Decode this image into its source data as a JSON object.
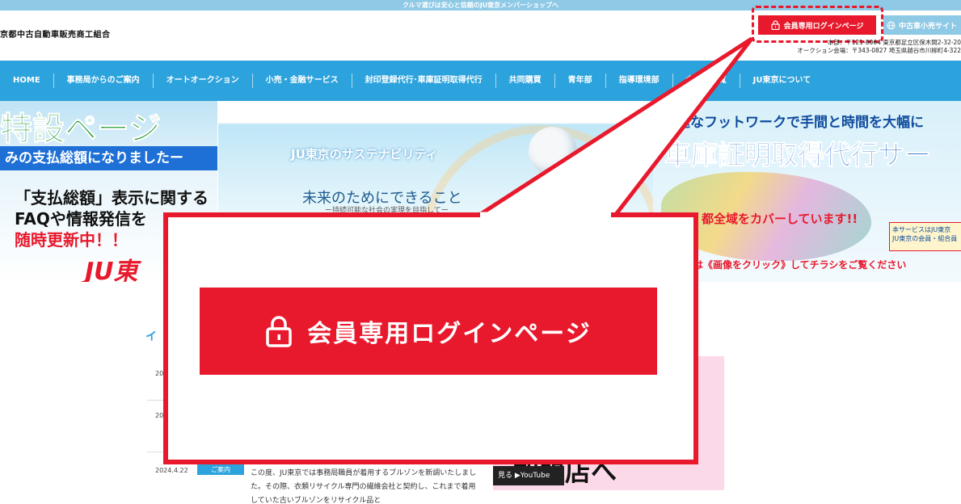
{
  "topbar": {
    "text": "クルマ選びは安心と信頼のJU東京メンバーショップへ"
  },
  "header": {
    "org_name": "京都中古自動車販売商工組合",
    "login_button": "会員専用ログインページ",
    "used_car_button": "中古車小売サイト",
    "address_line1": "本部：〒121-0064 東京都足立区保木間2-32-20",
    "address_line2": "オークション会場：〒343-0827 埼玉県越谷市川柳町4-322"
  },
  "nav": {
    "items": [
      {
        "label": "HOME"
      },
      {
        "label": "事務局からのご案内"
      },
      {
        "label": "オートオークション"
      },
      {
        "label": "小売・金融サービス"
      },
      {
        "label": "封印登録代行･車庫証明取得代行"
      },
      {
        "label": "共同購買"
      },
      {
        "label": "青年部"
      },
      {
        "label": "指導環境部"
      },
      {
        "label": "会員店一覧"
      },
      {
        "label": "JU東京について"
      }
    ]
  },
  "banners": {
    "left": {
      "title": "特設ページ",
      "subtitle": "みの支払総額になりましたー",
      "line1": "「支払総額」表示に関する",
      "line2": "FAQや情報発信を",
      "line3": "随時更新中！！",
      "logo": "JU東"
    },
    "middle": {
      "title": "JU東京のサステナビリティ",
      "heading": "未来のためにできること",
      "tagline": "ー持続可能な社会の実現を目指してー"
    },
    "right": {
      "top": "迅速なフットワークで手間と時間を大幅に",
      "main": "車庫証明取得代行サー",
      "cover": "都全域をカバーしています!!",
      "click": "は《画像をクリック》してチラシをご覧ください",
      "note": "本サービスはJU東京 JU東京の会員・組合員"
    }
  },
  "news": {
    "section_head": "イ",
    "rows": [
      {
        "date": "2024",
        "badge": "",
        "text": ""
      },
      {
        "date": "20",
        "badge": "",
        "text": ""
      },
      {
        "date": "2024.4.22",
        "badge": "ご案内",
        "text": "この度、JU東京では事務局職員が着用するブルゾンを新調いたしました。その際、衣類リサイクル専門の繊維会社と契約し、これまで着用していた古いブルゾンをリサイクル品と"
      }
    ]
  },
  "video": {
    "big_text": "加盟店へ",
    "watch_on": "見る ▶YouTube"
  },
  "callout": {
    "login_label": "会員専用ログインページ"
  },
  "colors": {
    "accent_red": "#e8192c",
    "nav_blue": "#2da3dd",
    "topbar_blue": "#8ec9e6"
  }
}
